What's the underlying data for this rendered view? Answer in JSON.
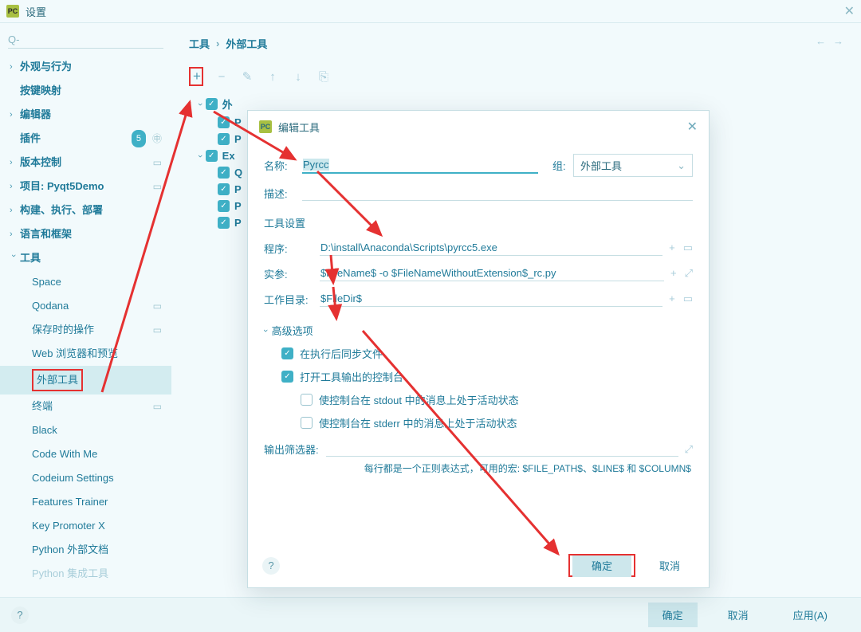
{
  "window": {
    "title": "设置"
  },
  "sidebar": {
    "items": [
      {
        "label": "外观与行为",
        "expandable": true
      },
      {
        "label": "按键映射",
        "expandable": false
      },
      {
        "label": "编辑器",
        "expandable": true
      },
      {
        "label": "插件",
        "expandable": false,
        "badge": "5"
      },
      {
        "label": "版本控制",
        "expandable": true
      },
      {
        "label": "项目: Pyqt5Demo",
        "expandable": true
      },
      {
        "label": "构建、执行、部署",
        "expandable": true
      },
      {
        "label": "语言和框架",
        "expandable": true
      },
      {
        "label": "工具",
        "expandable": true,
        "expanded": true
      }
    ],
    "tool_children": [
      {
        "label": "Space",
        "icon": false
      },
      {
        "label": "Qodana",
        "icon": true
      },
      {
        "label": "保存时的操作",
        "icon": true
      },
      {
        "label": "Web 浏览器和预览",
        "icon": false
      },
      {
        "label": "外部工具",
        "icon": false,
        "selected": true
      },
      {
        "label": "终端",
        "icon": true
      },
      {
        "label": "Black",
        "icon": false
      },
      {
        "label": "Code With Me",
        "icon": false
      },
      {
        "label": "Codeium Settings",
        "icon": false
      },
      {
        "label": "Features Trainer",
        "icon": false
      },
      {
        "label": "Key Promoter X",
        "icon": false
      },
      {
        "label": "Python 外部文档",
        "icon": false
      },
      {
        "label": "Python 集成工具",
        "icon": false
      }
    ]
  },
  "breadcrumb": {
    "root": "工具",
    "leaf": "外部工具"
  },
  "tree": {
    "g1": "外",
    "g1c1": "P",
    "g1c2": "P",
    "g2": "Ex",
    "g2c1": "Q",
    "g2c2": "P",
    "g2c3": "P",
    "g2c4": "P"
  },
  "dialog": {
    "title": "编辑工具",
    "name_label": "名称:",
    "name_value": "Pyrcc",
    "group_label": "组:",
    "group_value": "外部工具",
    "desc_label": "描述:",
    "tool_settings_label": "工具设置",
    "program_label": "程序:",
    "program_value": "D:\\install\\Anaconda\\Scripts\\pyrcc5.exe",
    "args_label": "实参:",
    "args_value": "$FileName$ -o $FileNameWithoutExtension$_rc.py",
    "wd_label": "工作目录:",
    "wd_value": "$FileDir$",
    "adv_label": "高级选项",
    "adv_sync": "在执行后同步文件",
    "adv_console": "打开工具输出的控制台",
    "adv_stdout": "使控制台在 stdout 中的消息上处于活动状态",
    "adv_stderr": "使控制台在 stderr 中的消息上处于活动状态",
    "filter_label": "输出筛选器:",
    "hint": "每行都是一个正则表达式，可用的宏: $FILE_PATH$、$LINE$ 和 $COLUMN$",
    "ok": "确定",
    "cancel": "取消"
  },
  "buttons": {
    "ok": "确定",
    "cancel": "取消",
    "apply": "应用(A)"
  }
}
